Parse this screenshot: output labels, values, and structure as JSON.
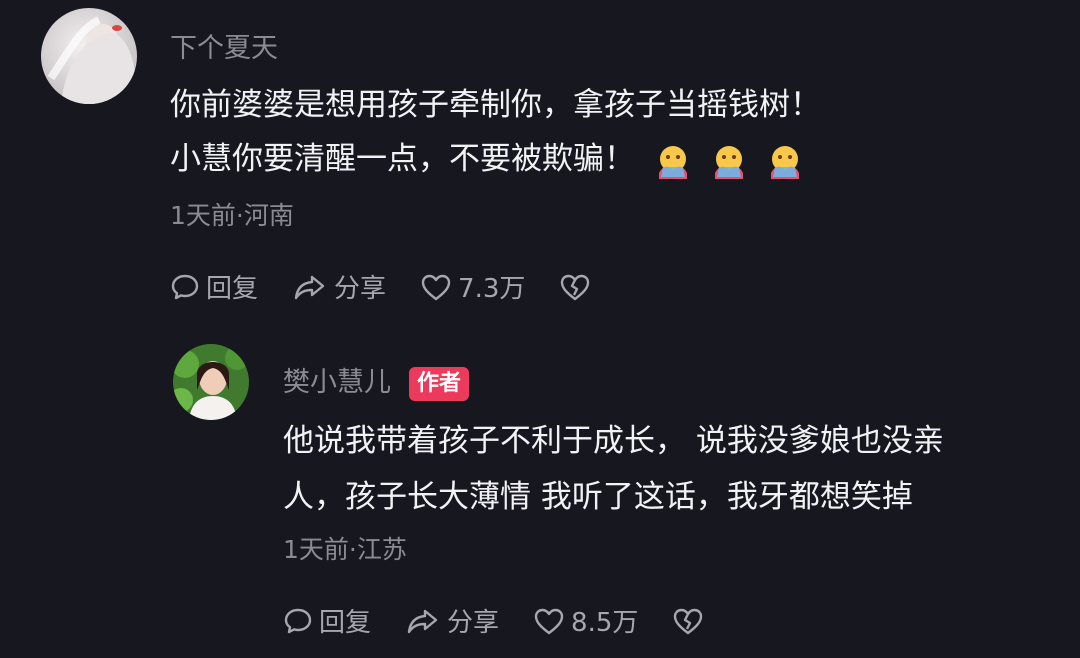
{
  "comments": [
    {
      "username": "下个夏天",
      "lines": [
        "你前婆婆是想用孩子牵制你，拿孩子当摇钱树！",
        "小慧你要清醒一点，不要被欺骗！"
      ],
      "emoji_count": 3,
      "emoji_icon": "hugging-face-icon",
      "meta": "1天前·河南",
      "reply_label": "回复",
      "share_label": "分享",
      "like_count": "7.3万"
    },
    {
      "username": "樊小慧儿",
      "badge": "作者",
      "lines": [
        "他说我带着孩子不利于成长， 说我没爹娘也没亲",
        "人，孩子长大薄情 我听了这话，我牙都想笑掉"
      ],
      "meta": "1天前·江苏",
      "reply_label": "回复",
      "share_label": "分享",
      "like_count": "8.5万"
    }
  ],
  "colors": {
    "background": "#17171f",
    "badge": "#ec3a5c",
    "secondary_text": "#8b8b94"
  }
}
